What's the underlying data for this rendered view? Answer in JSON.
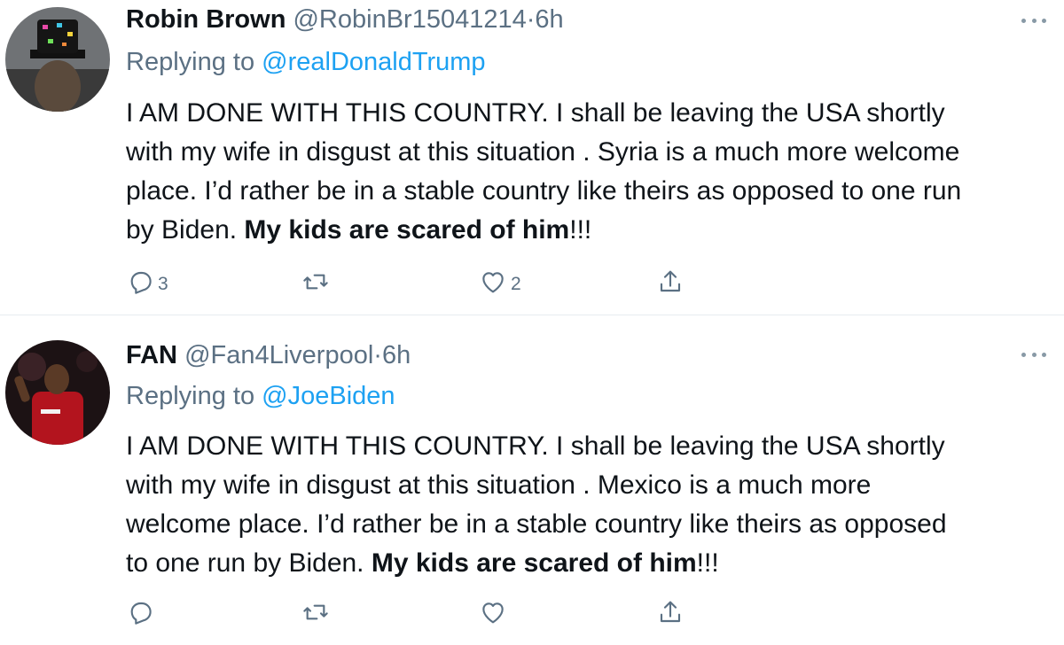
{
  "tweets": [
    {
      "name": "Robin Brown",
      "handle": "@RobinBr15041214",
      "separator": "·",
      "time": "6h",
      "replying_prefix": "Replying to ",
      "replying_to": "@realDonaldTrump",
      "text": "I AM DONE WITH THIS COUNTRY.  I shall be leaving the USA shortly\nwith my wife in disgust at this situation . Syria is a much more welcome\nplace. I’d rather be in a stable country like theirs as opposed to one run\nby Biden. ",
      "text_bold": "My kids are scared of him",
      "text_end": "!!!",
      "reply_count": "3",
      "retweet_count": "",
      "like_count": "2"
    },
    {
      "name": "FAN",
      "handle": "@Fan4Liverpool",
      "separator": "·",
      "time": "6h",
      "replying_prefix": "Replying to ",
      "replying_to": "@JoeBiden",
      "text": "I AM DONE WITH THIS COUNTRY.  I shall be leaving the USA shortly\nwith my wife in disgust at this situation . Mexico is a much more\nwelcome place. I’d rather be in a stable country like theirs as opposed\nto one run by Biden. ",
      "text_bold": "My kids are scared of him",
      "text_end": "!!!",
      "reply_count": "",
      "retweet_count": "",
      "like_count": ""
    }
  ],
  "icons": {
    "reply": "reply-icon",
    "retweet": "retweet-icon",
    "like": "heart-icon",
    "share": "share-icon",
    "more": "more-icon"
  },
  "colors": {
    "text": "#0f1419",
    "secondary": "#5b7083",
    "link": "#1da1f2",
    "divider": "#e6ecf0"
  }
}
